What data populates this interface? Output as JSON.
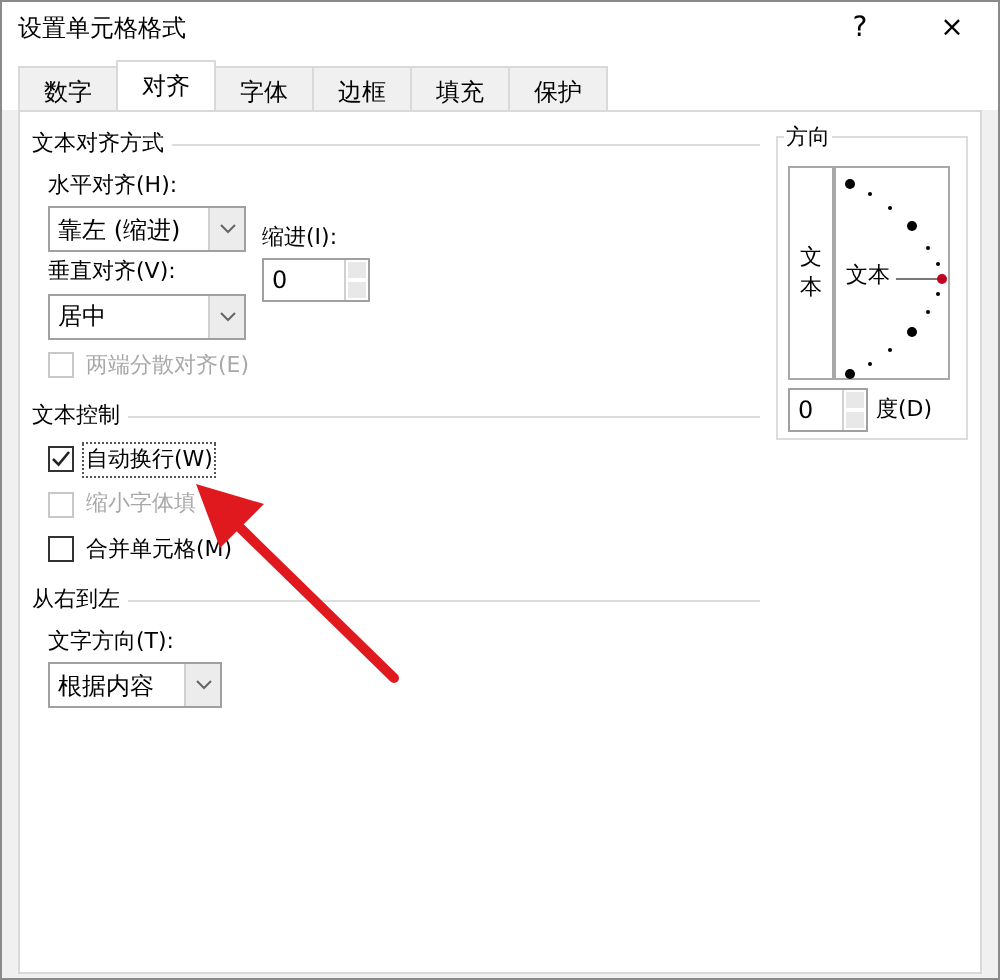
{
  "window": {
    "title": "设置单元格格式",
    "help": "?",
    "close": "×"
  },
  "tabs": [
    {
      "label": "数字",
      "selected": false
    },
    {
      "label": "对齐",
      "selected": true
    },
    {
      "label": "字体",
      "selected": false
    },
    {
      "label": "边框",
      "selected": false
    },
    {
      "label": "填充",
      "selected": false
    },
    {
      "label": "保护",
      "selected": false
    }
  ],
  "text_alignment": {
    "title": "文本对齐方式",
    "horizontal_label": "水平对齐(H):",
    "horizontal_value": "靠左 (缩进)",
    "indent_label": "缩进(I):",
    "indent_value": "0",
    "vertical_label": "垂直对齐(V):",
    "vertical_value": "居中",
    "distributed": {
      "label": "两端分散对齐(E)",
      "checked": false,
      "disabled": true
    }
  },
  "text_control": {
    "title": "文本控制",
    "options": [
      {
        "label": "自动换行(W)",
        "checked": true,
        "disabled": false,
        "focused": true
      },
      {
        "label": "缩小字体填",
        "checked": false,
        "disabled": true,
        "focused": false
      },
      {
        "label": "合并单元格(M)",
        "checked": false,
        "disabled": false,
        "focused": false
      }
    ]
  },
  "right_to_left": {
    "title": "从右到左",
    "direction_label": "文字方向(T):",
    "direction_value": "根据内容"
  },
  "orientation": {
    "title": "方向",
    "vertical_text": "文本",
    "dial_text": "文本",
    "degrees_value": "0",
    "degrees_label": "度(D)"
  }
}
